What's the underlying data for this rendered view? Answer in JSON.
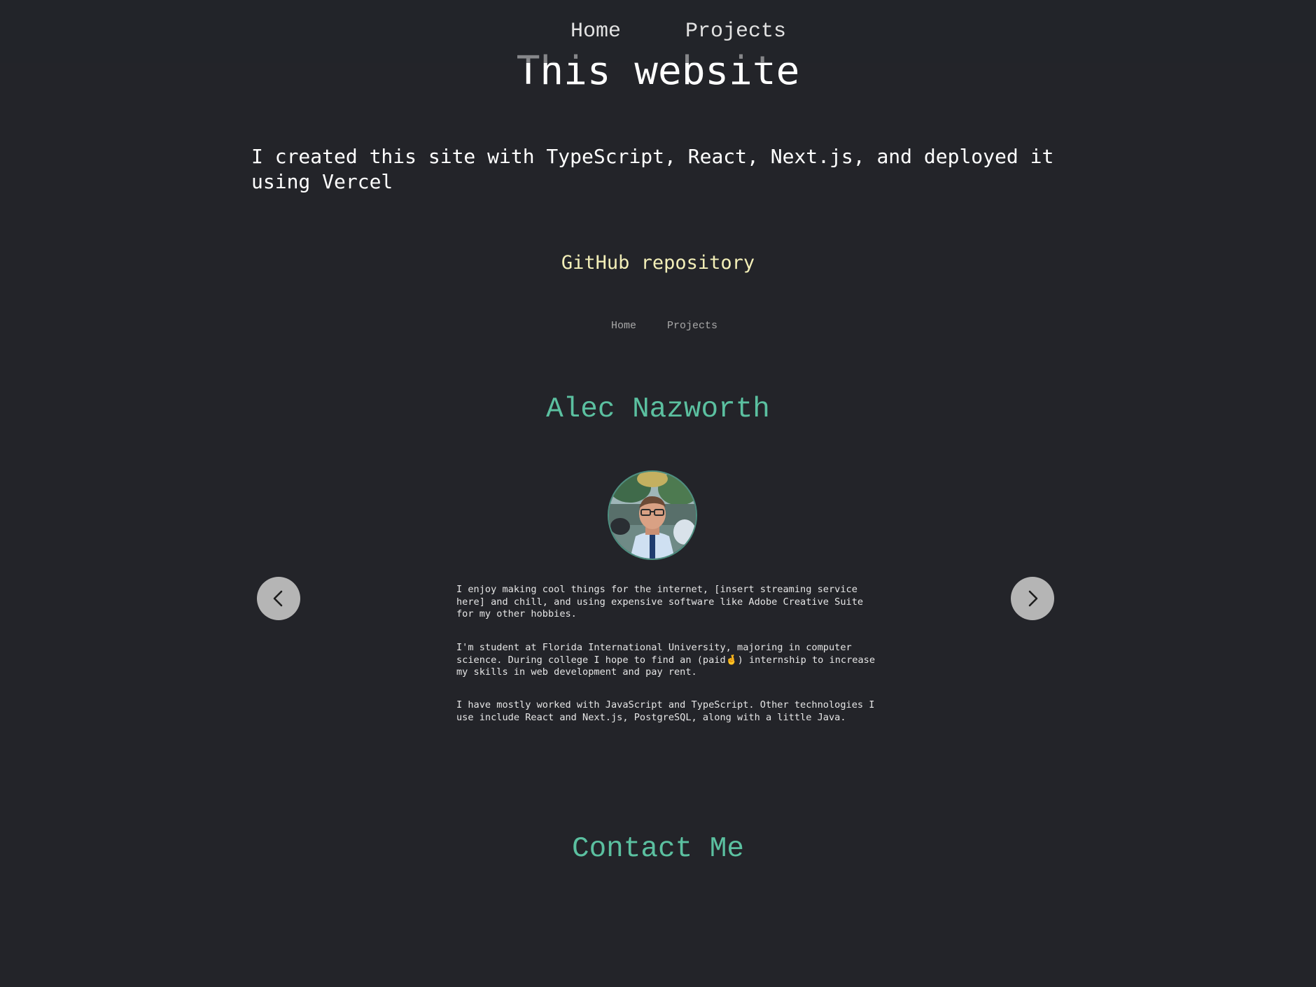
{
  "top_nav": {
    "home_label": "Home",
    "projects_label": "Projects"
  },
  "page_title": "This website",
  "intro_text": "I created this site with TypeScript, React, Next.js, and deployed it using Vercel",
  "repo_link_label": "GitHub repository",
  "preview": {
    "nav": {
      "home_label": "Home",
      "projects_label": "Projects"
    },
    "name": "Alec Nazworth",
    "avatar_icon": "profile-photo",
    "prev_icon": "chevron-left-icon",
    "next_icon": "chevron-right-icon",
    "bio": [
      "I enjoy making cool things for the internet, [insert streaming service here] and chill, and using expensive software like Adobe Creative Suite for my other hobbies.",
      "I'm student at Florida International University, majoring in computer science. During college I hope to find an (paid🤞) internship to increase my skills in web development and pay rent.",
      "I have mostly worked with JavaScript and TypeScript. Other technologies I use include React and Next.js, PostgreSQL, along with a little Java."
    ],
    "contact_heading": "Contact Me"
  },
  "colors": {
    "background": "#232429",
    "accent": "#5bc0a0",
    "link": "#f3efb8"
  }
}
